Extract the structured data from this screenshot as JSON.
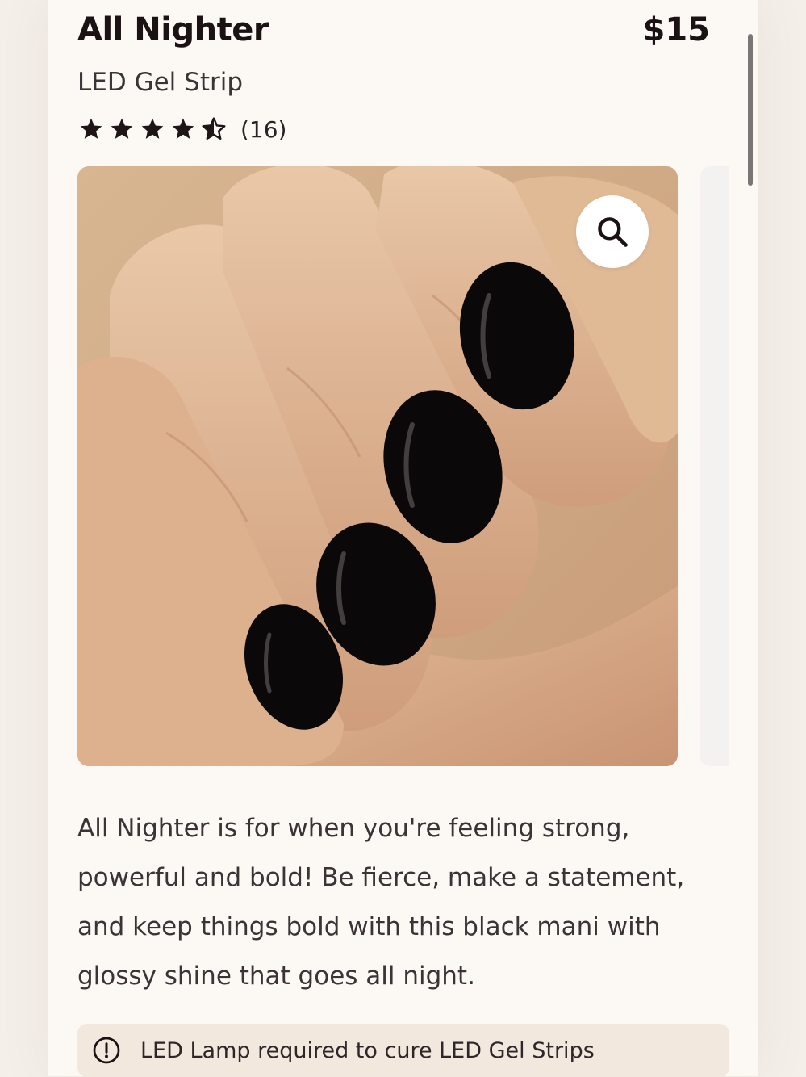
{
  "product": {
    "title": "All Nighter",
    "price": "$15",
    "subtitle": "LED Gel Strip",
    "rating": {
      "value": 4.5,
      "max": 5,
      "count_text": "(16)"
    },
    "description": "All Nighter is for when you're feeling strong, powerful and bold! Be fierce, make a statement, and keep things bold with this black mani with glossy shine that goes all night."
  },
  "gallery": {
    "zoom_icon": "search-icon",
    "image_subject": "hand-with-black-glossy-nails"
  },
  "notice": {
    "icon": "info-circle-icon",
    "text": "LED Lamp required to cure LED Gel Strips"
  },
  "colors": {
    "page_background": "#fcf9f5",
    "text_primary": "#1a1213",
    "notice_background": "#f2e8de",
    "star_color": "#1f1416"
  }
}
